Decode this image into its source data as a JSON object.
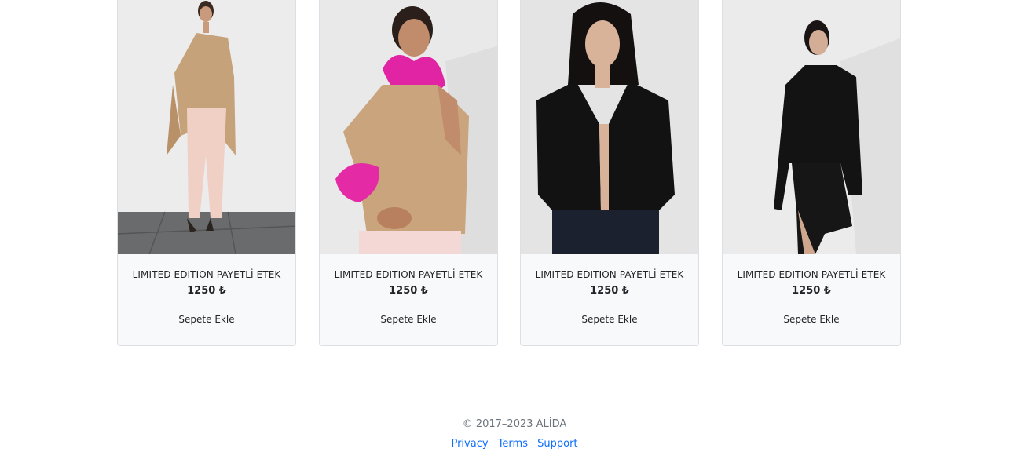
{
  "products": [
    {
      "name": "LIMITED EDITION PAYETLİ ETEK",
      "price": "1250 ₺",
      "add_label": "Sepete Ekle",
      "image": "model-beige-poncho-pink-trousers"
    },
    {
      "name": "LIMITED EDITION PAYETLİ ETEK",
      "price": "1250 ₺",
      "add_label": "Sepete Ekle",
      "image": "model-beige-knit-pink-feathers"
    },
    {
      "name": "LIMITED EDITION PAYETLİ ETEK",
      "price": "1250 ₺",
      "add_label": "Sepete Ekle",
      "image": "model-black-cropped-blazer"
    },
    {
      "name": "LIMITED EDITION PAYETLİ ETEK",
      "price": "1250 ₺",
      "add_label": "Sepete Ekle",
      "image": "model-black-blazer-skirt"
    }
  ],
  "footer": {
    "copyright": "© 2017–2023 ALİDA",
    "links": [
      "Privacy",
      "Terms",
      "Support"
    ]
  },
  "colors": {
    "link": "#0d6efd",
    "card_background": "#f8f9fa",
    "muted_text": "#6c757d"
  }
}
